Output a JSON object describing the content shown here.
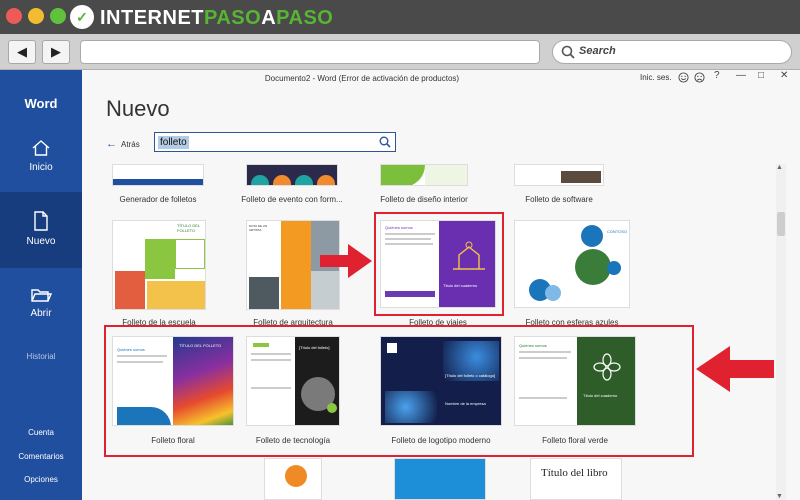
{
  "site": {
    "brand_white": "INTERNET",
    "brand_green": "PASO",
    "brand_white2": "A",
    "brand_green2": "PASO",
    "logo_glyph": "✓"
  },
  "browser": {
    "search_label": "Search",
    "back_glyph": "◀",
    "forward_glyph": "▶"
  },
  "window": {
    "title": "Documento2  -  Word (Error de activación de productos)",
    "account": "Inic. ses.",
    "help": "?",
    "min": "—",
    "max": "□",
    "close": "✕"
  },
  "sidebar": {
    "app_name": "Word",
    "items": [
      {
        "label": "Inicio",
        "icon": "home-icon"
      },
      {
        "label": "Nuevo",
        "icon": "new-document-icon"
      },
      {
        "label": "Abrir",
        "icon": "folder-icon"
      }
    ],
    "history": "Historial",
    "footer": [
      "Cuenta",
      "Comentarios",
      "Opciones"
    ]
  },
  "main": {
    "heading": "Nuevo",
    "back": "Atrás",
    "search_value": "folleto"
  },
  "templates": {
    "row1": [
      "Generador de folletos",
      "Folleto de evento con form...",
      "Folleto de diseño interior",
      "Folleto de software"
    ],
    "row2": [
      "Folleto de la escuela",
      "Folleto de arquitectura",
      "Folleto de viajes",
      "Folleto con esferas azules"
    ],
    "row3": [
      "Folleto floral",
      "Folleto de tecnología",
      "Folleto de logotipo moderno",
      "Folleto floral verde"
    ],
    "row4_partial": "Título del libro"
  },
  "thumbs": {
    "viajes_a": "Quiénes somos",
    "viajes_b": "Título del cuaderno",
    "floral_a": "Quiénes somos",
    "floral_b": "TÍTULO DEL FOLLETO",
    "tech_a": "[Título del folleto]",
    "logo_a": "[Título del folleto o catálogo]",
    "logo_b": "Nombre de la empresa",
    "green_a": "Quiénes somos",
    "green_b": "Título del cuaderno",
    "school_a": "TÍTULO DEL FOLLETO",
    "arch_a": "NOTA DE UN ARTISTA",
    "spheres_a": "CONTOSO"
  },
  "colors": {
    "word_blue": "#1f4f9e",
    "highlight_red": "#e0212f",
    "brand_green": "#58b433"
  }
}
